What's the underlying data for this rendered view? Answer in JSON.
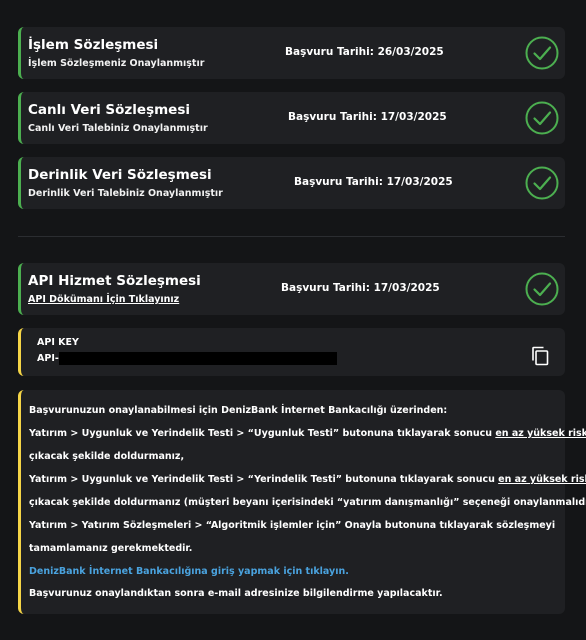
{
  "contracts": [
    {
      "title": "İşlem Sözleşmesi",
      "subtitle": "İşlem Sözleşmeniz Onaylanmıştır",
      "date": "Başvuru Tarihi: 26/03/2025",
      "status_icon": "check-circle-icon",
      "accent": "#4caf50"
    },
    {
      "title": "Canlı Veri Sözleşmesi",
      "subtitle": "Canlı Veri Talebiniz Onaylanmıştır",
      "date": "Başvuru Tarihi: 17/03/2025",
      "status_icon": "check-circle-icon",
      "accent": "#4caf50"
    },
    {
      "title": "Derinlik Veri Sözleşmesi",
      "subtitle": "Derinlik Veri Talebiniz Onaylanmıştır",
      "date": "Başvuru Tarihi: 17/03/2025",
      "status_icon": "check-circle-icon",
      "accent": "#4caf50"
    }
  ],
  "api_service": {
    "title": "API Hizmet Sözleşmesi",
    "doc_link": "API Dökümanı İçin Tıklayınız",
    "date": "Başvuru Tarihi: 17/03/2025",
    "status_icon": "check-circle-icon"
  },
  "api_key": {
    "label": "API KEY",
    "prefix": "API-",
    "copy_icon": "copy-icon",
    "accent": "#f5d547"
  },
  "info": {
    "intro": "Başvurunuzun onaylanabilmesi için DenizBank İnternet Bankacılığı üzerinden:",
    "step1_a": "Yatırım > Uygunluk ve Yerindelik Testi > “Uygunluk Testi” butonuna tıklayarak sonucu ",
    "step1_u": "en az yüksek riskli",
    "step1_b": "çıkacak şekilde doldurmanız,",
    "step2_a": "Yatırım > Uygunluk ve Yerindelik Testi > “Yerindelik Testi” butonuna tıklayarak sonucu ",
    "step2_u": "en az yüksek riskli",
    "step2_b": "çıkacak şekilde doldurmanız (müşteri beyanı içerisindeki “yatırım danışmanlığı” seçeneği onaylanmalıdır),",
    "step3_a": "Yatırım > Yatırım Sözleşmeleri > “Algoritmik işlemler için” Onayla butonuna tıklayarak sözleşmeyi",
    "step3_b": "tamamlamanız gerekmektedir.",
    "login_link": "DenizBank İnternet Bankacılığına giriş yapmak için tıklayın.",
    "footer": "Başvurunuz onaylandıktan sonra e-mail adresinize bilgilendirme yapılacaktır.",
    "link_color": "#4aa3df"
  }
}
